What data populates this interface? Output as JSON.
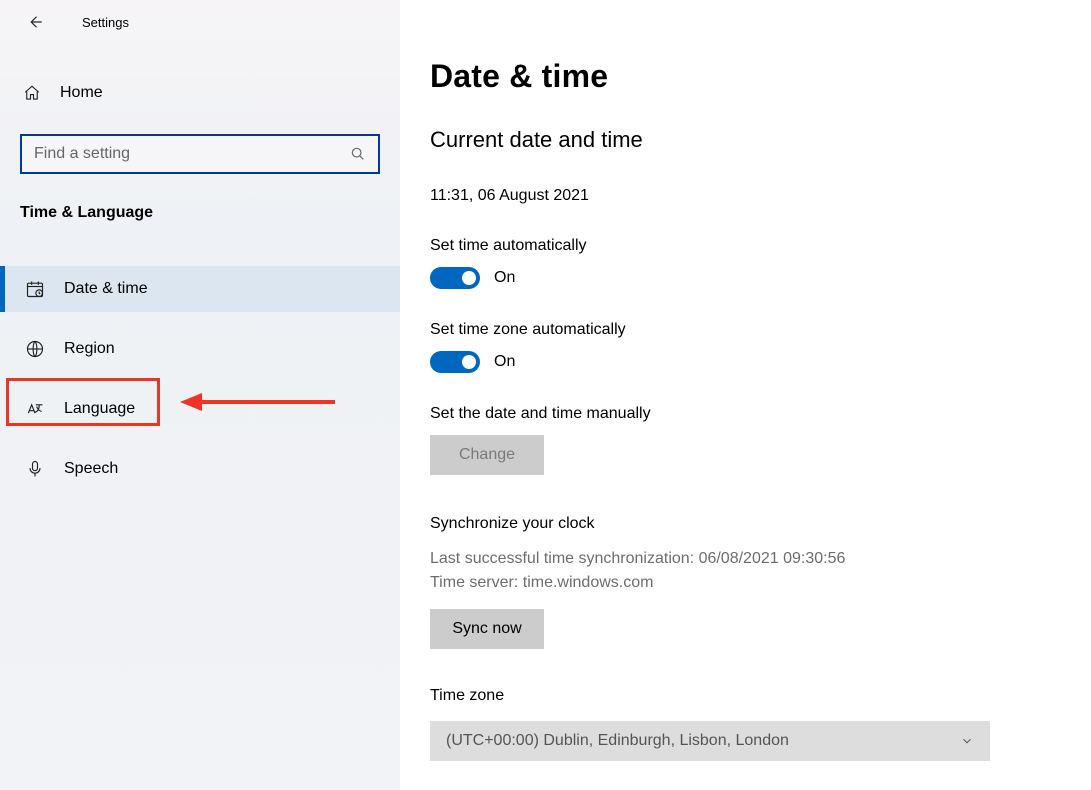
{
  "topbar": {
    "title": "Settings"
  },
  "home": {
    "label": "Home"
  },
  "search": {
    "placeholder": "Find a setting"
  },
  "category": "Time & Language",
  "nav": [
    {
      "id": "date-time",
      "label": "Date & time",
      "active": true
    },
    {
      "id": "region",
      "label": "Region",
      "active": false
    },
    {
      "id": "language",
      "label": "Language",
      "active": false
    },
    {
      "id": "speech",
      "label": "Speech",
      "active": false
    }
  ],
  "page": {
    "title": "Date & time",
    "current_section": "Current date and time",
    "current_value": "11:31, 06 August 2021",
    "auto_time_label": "Set time automatically",
    "auto_time_state": "On",
    "auto_tz_label": "Set time zone automatically",
    "auto_tz_state": "On",
    "manual_label": "Set the date and time manually",
    "change_btn": "Change",
    "sync_label": "Synchronize your clock",
    "sync_last": "Last successful time synchronization: 06/08/2021 09:30:56",
    "sync_server": "Time server: time.windows.com",
    "sync_btn": "Sync now",
    "tz_label": "Time zone",
    "tz_value": "(UTC+00:00) Dublin, Edinburgh, Lisbon, London"
  },
  "colors": {
    "accent": "#0067c0",
    "annotation": "#ee3424"
  }
}
